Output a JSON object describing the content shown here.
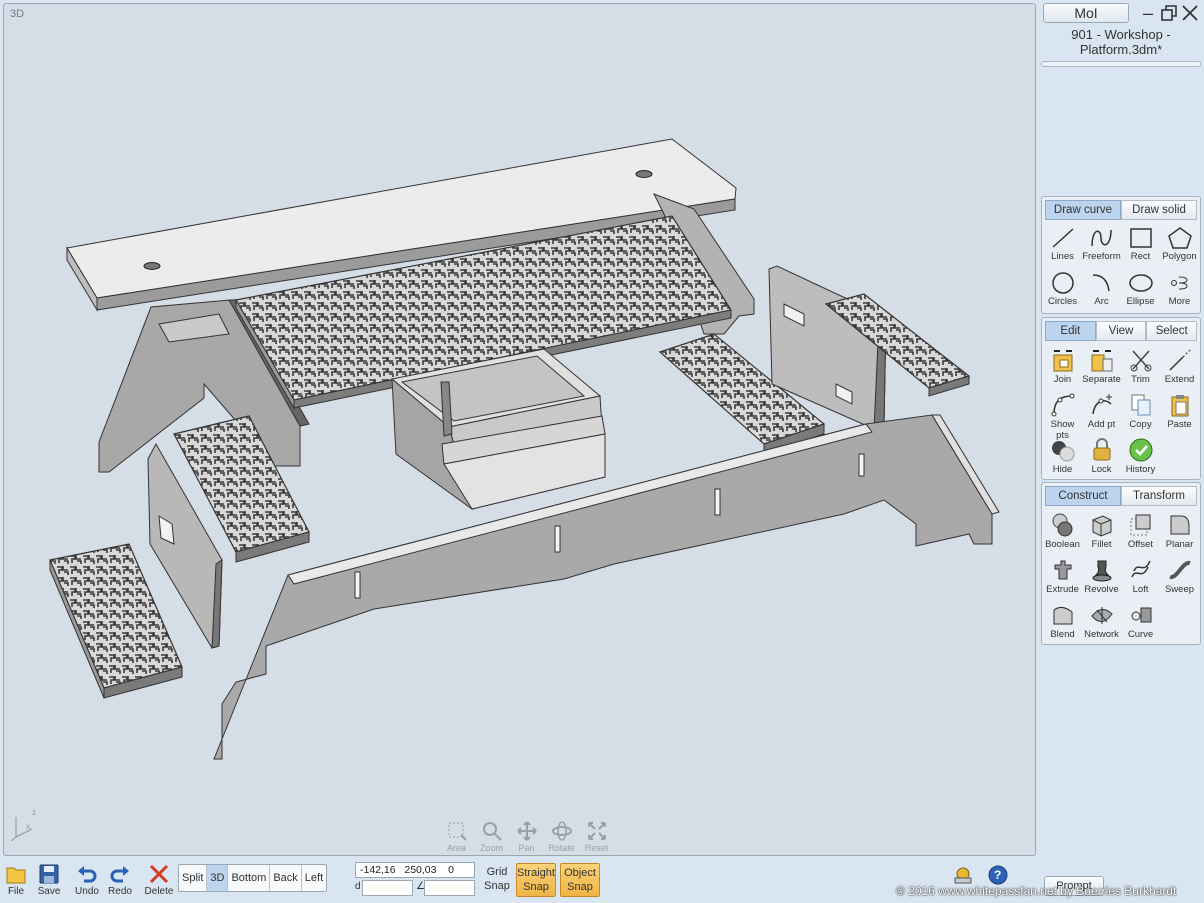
{
  "viewport": {
    "label": "3D"
  },
  "nav": [
    "Area",
    "Zoom",
    "Pan",
    "Rotate",
    "Reset"
  ],
  "app": {
    "name": "MoI",
    "file_name": "901 - Workshop - Platform.3dm*"
  },
  "draw_palette": {
    "tabs": [
      "Draw curve",
      "Draw solid"
    ],
    "tools": [
      {
        "label": "Lines",
        "icon": "lines-icon"
      },
      {
        "label": "Freeform",
        "icon": "freeform-icon"
      },
      {
        "label": "Rect",
        "icon": "rect-icon"
      },
      {
        "label": "Polygon",
        "icon": "polygon-icon"
      },
      {
        "label": "Circles",
        "icon": "circle-icon"
      },
      {
        "label": "Arc",
        "icon": "arc-icon"
      },
      {
        "label": "Ellipse",
        "icon": "ellipse-icon"
      },
      {
        "label": "More",
        "icon": "more-icon"
      }
    ]
  },
  "edit_palette": {
    "tabs": [
      "Edit",
      "View",
      "Select"
    ],
    "tools": [
      {
        "label": "Join",
        "icon": "join-icon"
      },
      {
        "label": "Separate",
        "icon": "separate-icon"
      },
      {
        "label": "Trim",
        "icon": "trim-icon"
      },
      {
        "label": "Extend",
        "icon": "extend-icon"
      },
      {
        "label": "Show pts",
        "icon": "show-points-icon"
      },
      {
        "label": "Add pt",
        "icon": "add-point-icon"
      },
      {
        "label": "Copy",
        "icon": "copy-icon"
      },
      {
        "label": "Paste",
        "icon": "paste-icon"
      },
      {
        "label": "Hide",
        "icon": "hide-icon"
      },
      {
        "label": "Lock",
        "icon": "lock-icon"
      },
      {
        "label": "History",
        "icon": "history-icon"
      }
    ]
  },
  "construct_palette": {
    "tabs": [
      "Construct",
      "Transform"
    ],
    "tools": [
      {
        "label": "Boolean",
        "icon": "boolean-icon"
      },
      {
        "label": "Fillet",
        "icon": "fillet-icon"
      },
      {
        "label": "Offset",
        "icon": "offset-icon"
      },
      {
        "label": "Planar",
        "icon": "planar-icon"
      },
      {
        "label": "Extrude",
        "icon": "extrude-icon"
      },
      {
        "label": "Revolve",
        "icon": "revolve-icon"
      },
      {
        "label": "Loft",
        "icon": "loft-icon"
      },
      {
        "label": "Sweep",
        "icon": "sweep-icon"
      },
      {
        "label": "Blend",
        "icon": "blend-icon"
      },
      {
        "label": "Network",
        "icon": "network-icon"
      },
      {
        "label": "Curve",
        "icon": "curve-icon"
      }
    ]
  },
  "toolbar": {
    "file": "File",
    "save": "Save",
    "undo": "Undo",
    "redo": "Redo",
    "delete": "Delete",
    "views": [
      "Split",
      "3D",
      "Bottom",
      "Back",
      "Left"
    ],
    "coords": "-142,16   250,03    0",
    "d_label": "d",
    "angle_label": "∠",
    "grid_snap": [
      "Grid",
      "Snap"
    ],
    "straight_snap": [
      "Straight",
      "Snap"
    ],
    "object_snap": [
      "Object",
      "Snap"
    ]
  },
  "copyright": "© 2016 www.whitepassfan.net by Boerries Burkhardt",
  "prompt": "Prompt",
  "colors": {
    "accent_blue": "#bcd4ee",
    "snap_orange": "#f0b445",
    "viewport_bg": "#d5dde6"
  }
}
